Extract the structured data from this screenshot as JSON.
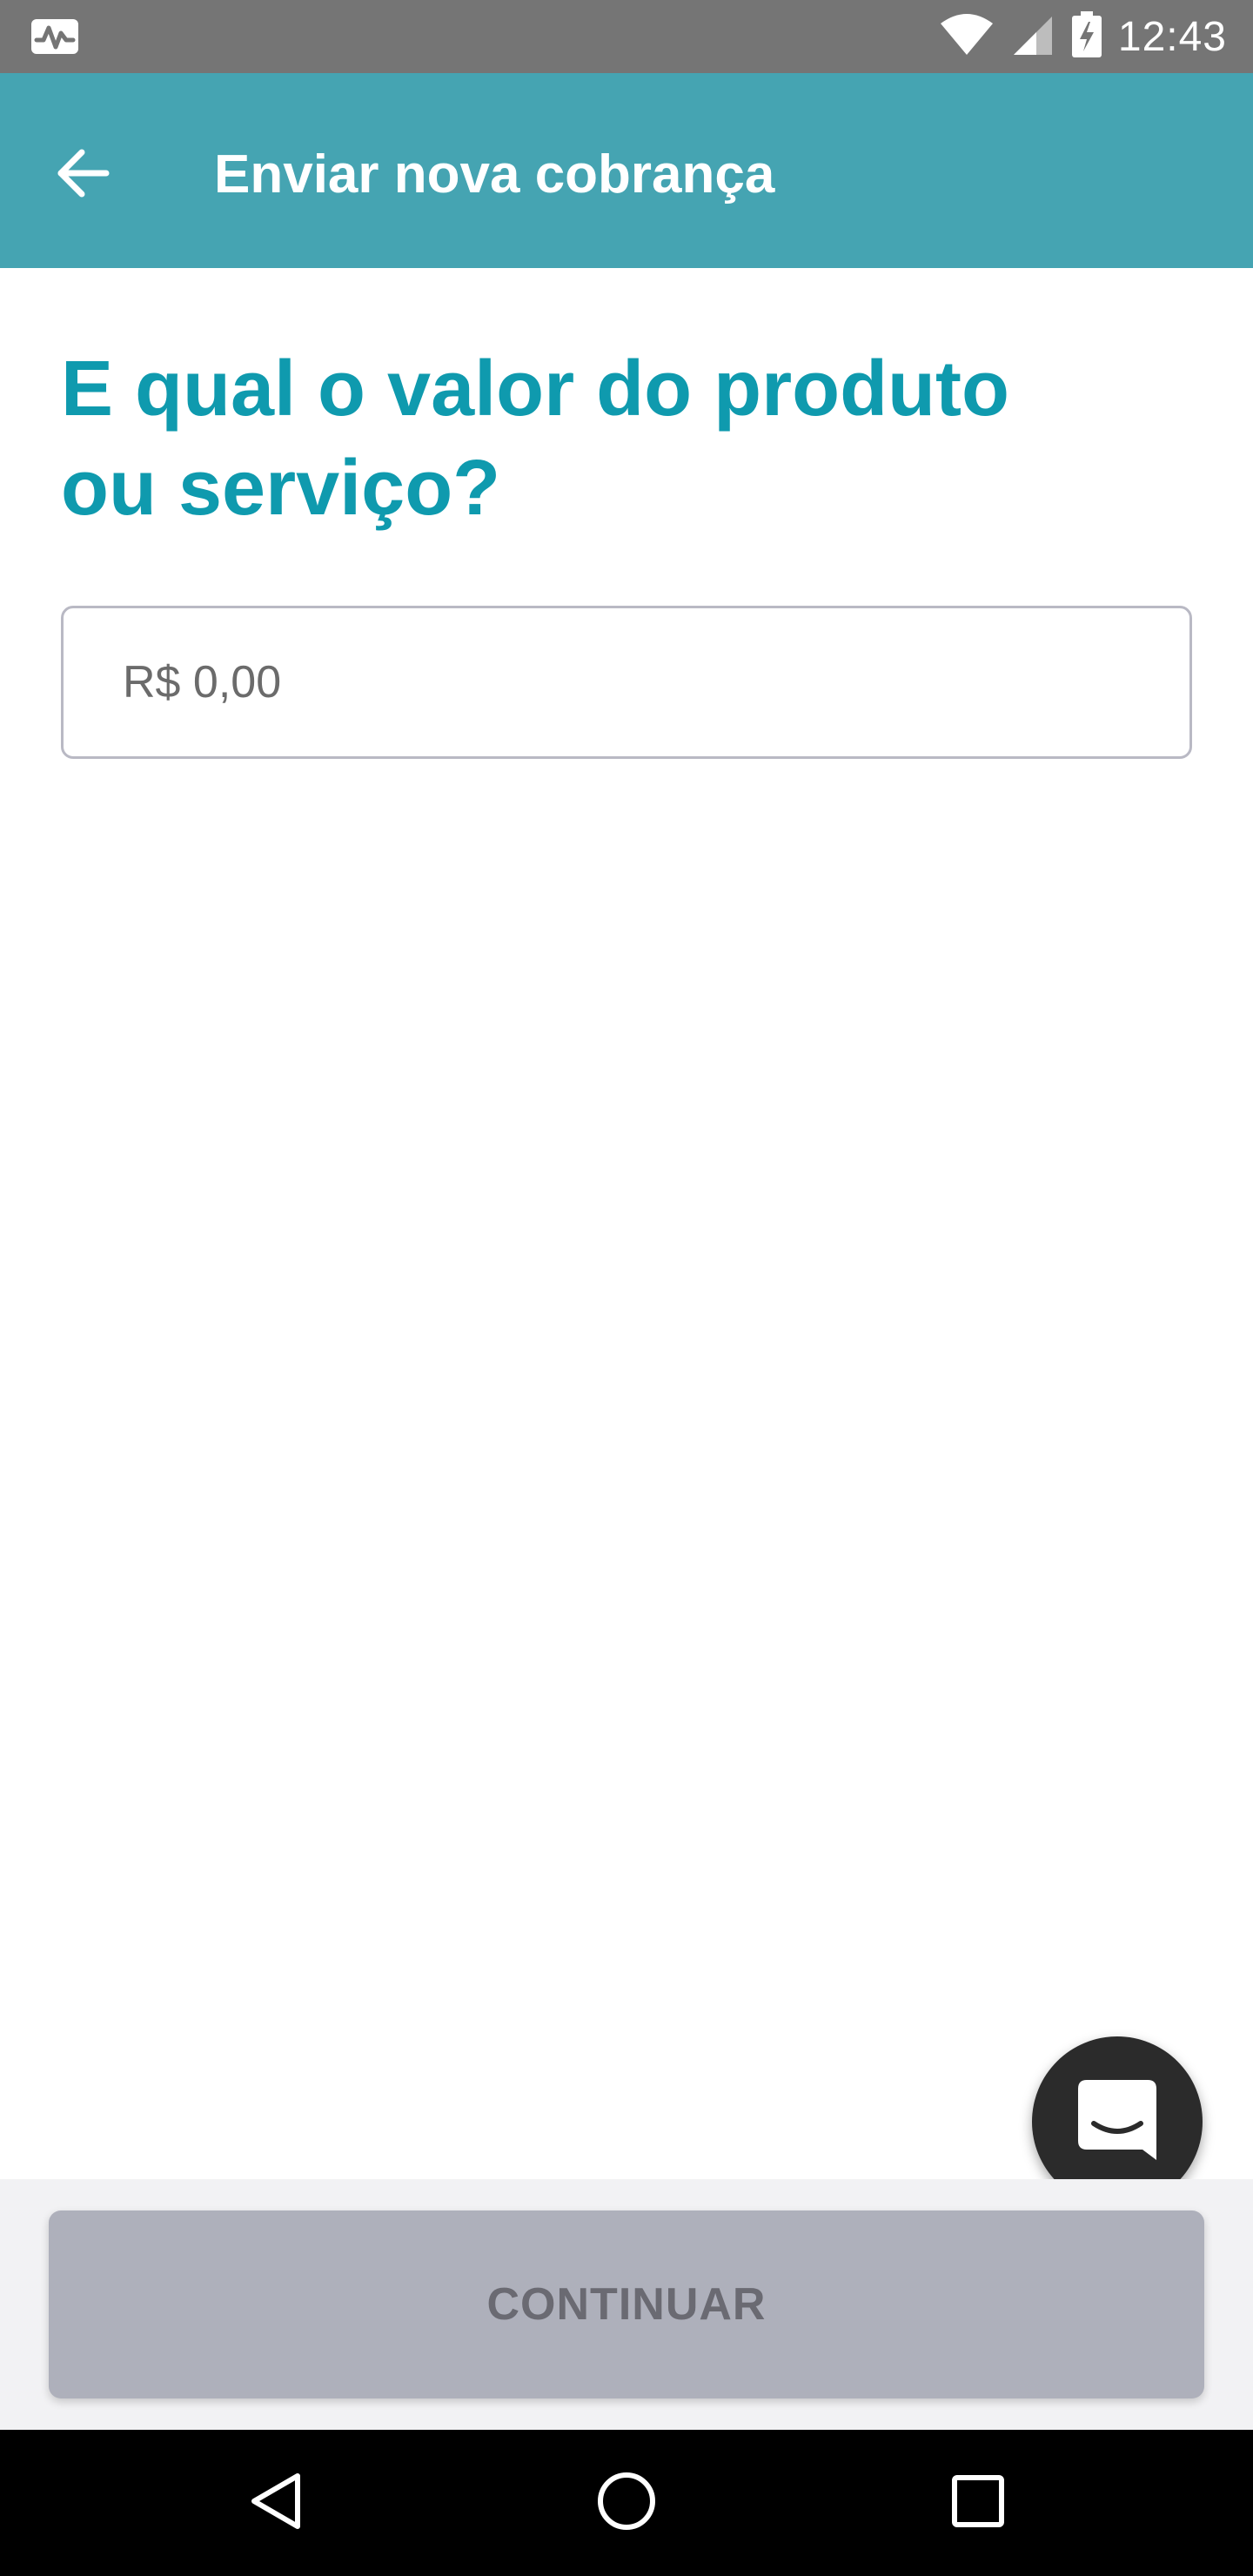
{
  "status_bar": {
    "time": "12:43",
    "icons": [
      "activity-icon",
      "wifi-icon",
      "signal-icon",
      "battery-charging-icon"
    ]
  },
  "app_bar": {
    "title": "Enviar nova cobrança",
    "back_icon": "arrow-left-icon"
  },
  "main": {
    "question": "E qual o valor do produto ou serviço?",
    "value_field": {
      "placeholder": "R$ 0,00",
      "value": ""
    }
  },
  "chat": {
    "icon": "chat-icon"
  },
  "footer": {
    "continue_label": "CONTINUAR"
  },
  "nav_bar": {
    "icons": [
      "nav-back-icon",
      "nav-home-icon",
      "nav-recents-icon"
    ]
  },
  "colors": {
    "status_bar": "#757575",
    "app_bar": "#45a4b2",
    "accent_text": "#0f9aae",
    "button_disabled": "#aeb0bb",
    "fab": "#2b2b2b"
  }
}
